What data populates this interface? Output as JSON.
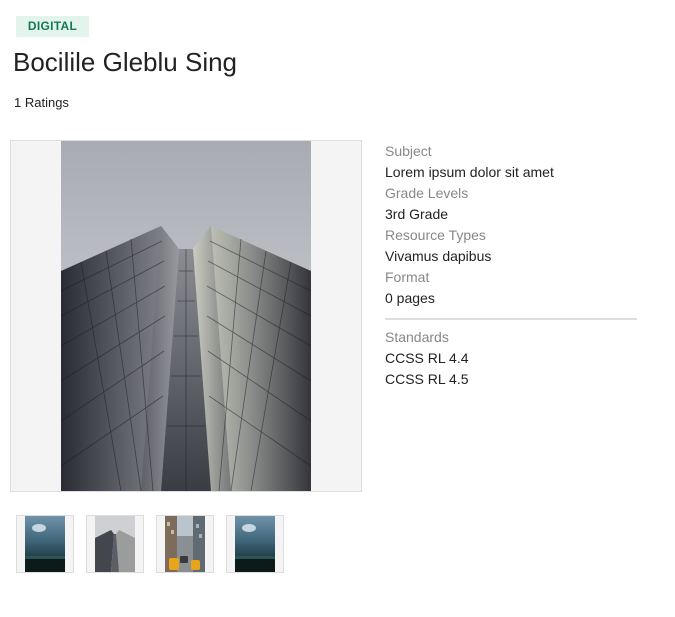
{
  "badge": "DIGITAL",
  "title": "Bocilile Gleblu Sing",
  "ratings": "1 Ratings",
  "details": {
    "subject_label": "Subject",
    "subject_value": "Lorem ipsum dolor sit amet",
    "grade_label": "Grade Levels",
    "grade_value": "3rd Grade",
    "resource_label": "Resource Types",
    "resource_value": "Vivamus dapibus",
    "format_label": "Format",
    "format_value": "0 pages",
    "standards_label": "Standards",
    "standards": [
      "CCSS RL 4.4",
      "CCSS RL 4.5"
    ]
  },
  "images": {
    "main": "skyscraper-photo",
    "thumbnails": [
      "storm-sky-photo",
      "skyscraper-photo",
      "city-street-taxi-photo",
      "storm-sky-photo"
    ],
    "selected_thumbnail": 2
  }
}
